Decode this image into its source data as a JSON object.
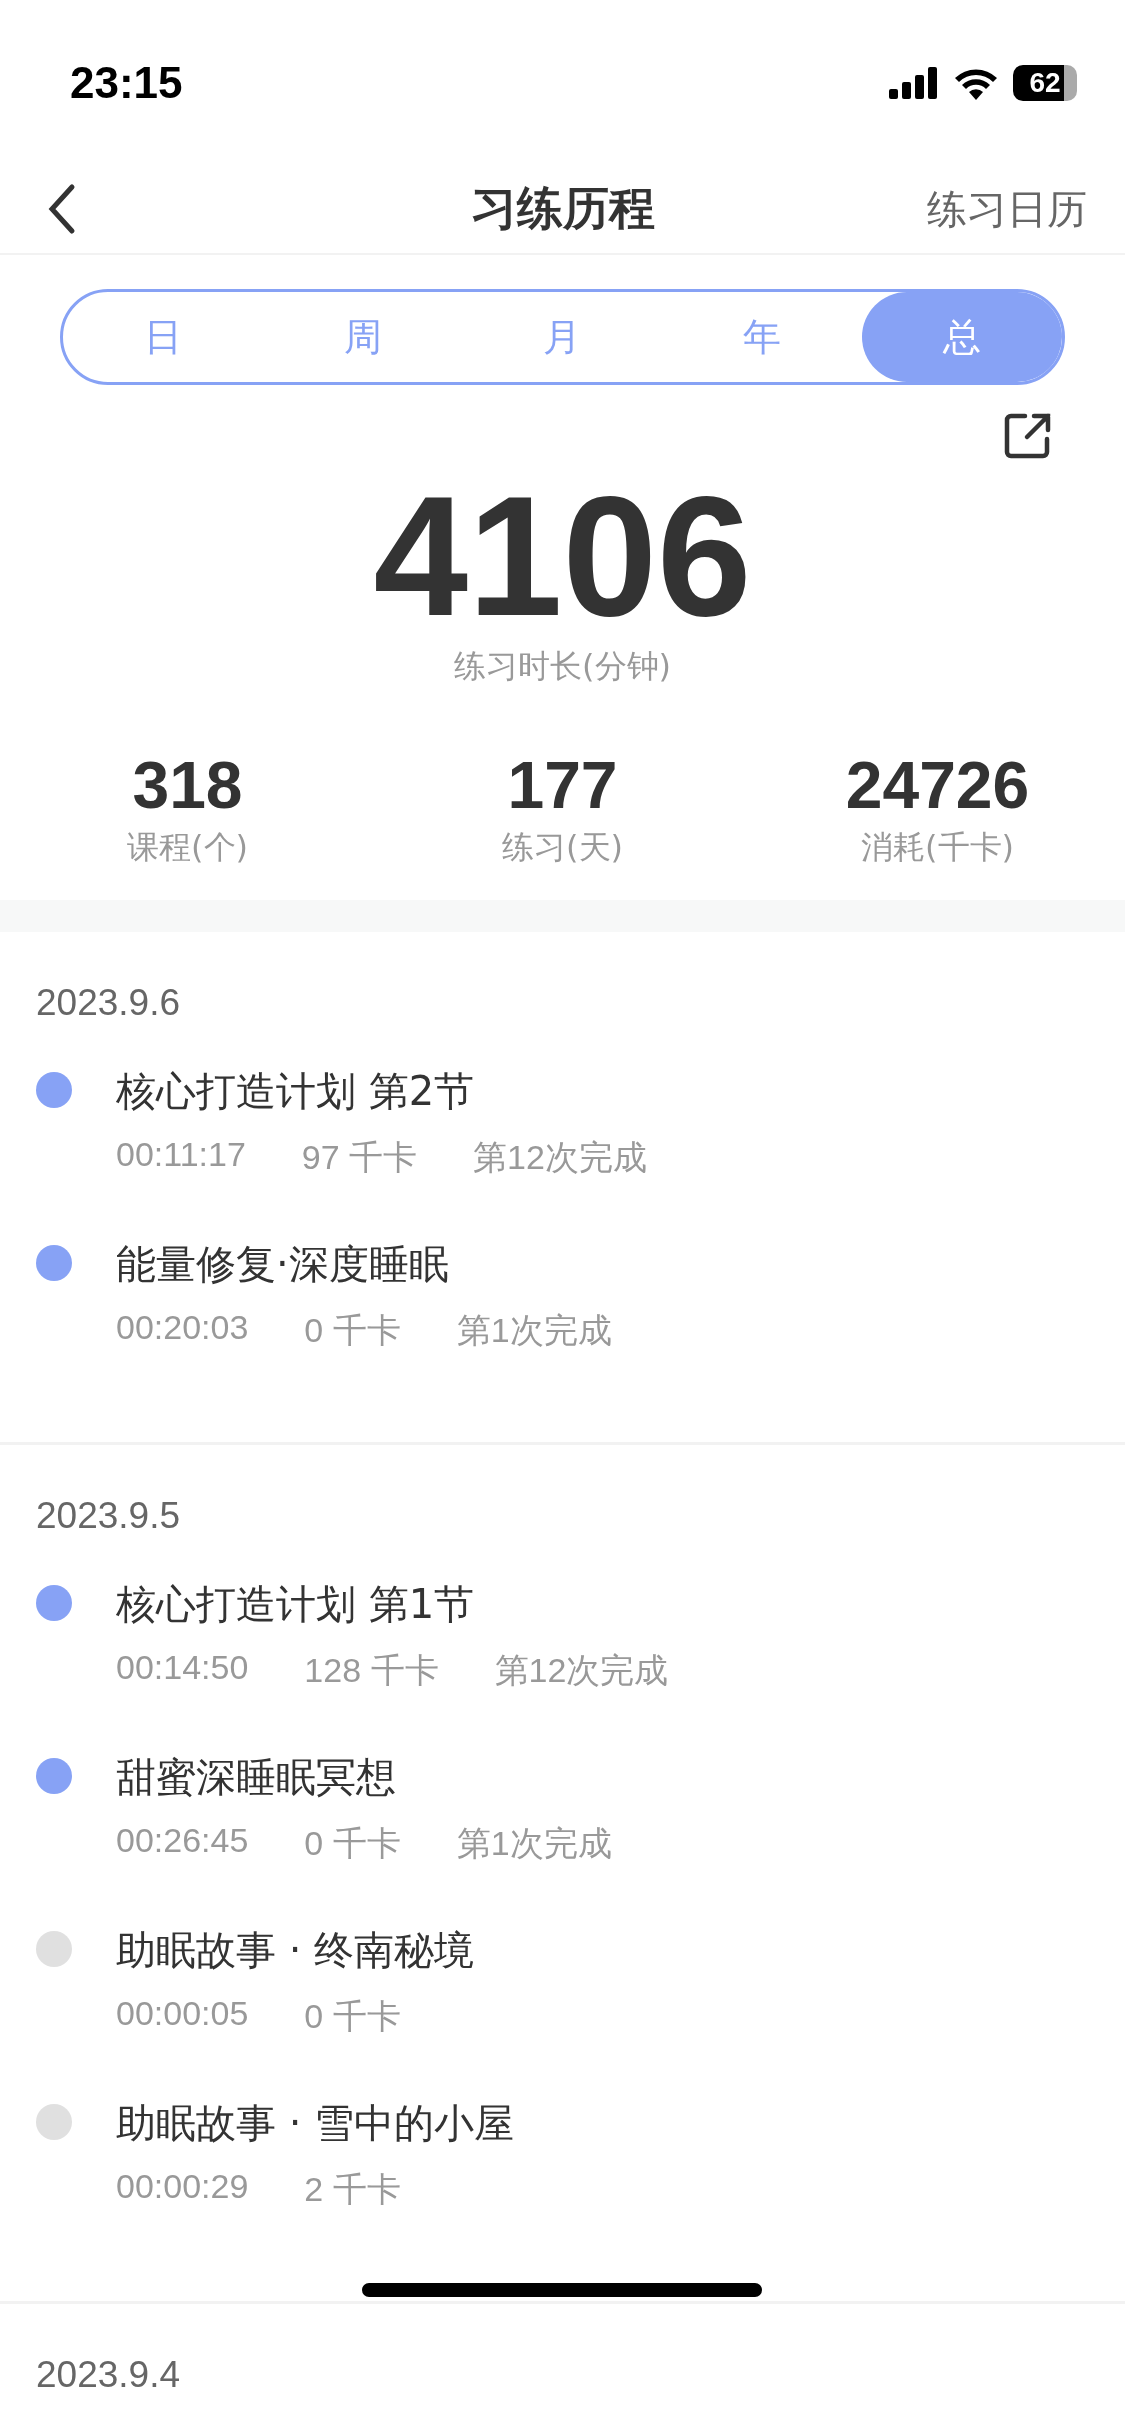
{
  "status_bar": {
    "time": "23:15",
    "battery": "62"
  },
  "header": {
    "title": "习练历程",
    "action": "练习日历"
  },
  "tabs": [
    {
      "label": "日",
      "selected": false
    },
    {
      "label": "周",
      "selected": false
    },
    {
      "label": "月",
      "selected": false
    },
    {
      "label": "年",
      "selected": false
    },
    {
      "label": "总",
      "selected": true
    }
  ],
  "summary": {
    "value": "4106",
    "label": "练习时长(分钟)"
  },
  "stats": [
    {
      "value": "318",
      "label": "课程(个)"
    },
    {
      "value": "177",
      "label": "练习(天)"
    },
    {
      "value": "24726",
      "label": "消耗(千卡)"
    }
  ],
  "days": [
    {
      "date": "2023.9.6",
      "sessions": [
        {
          "title": "核心打造计划 第2节",
          "color": "#87a2f5",
          "duration": "00:11:17",
          "calories": "97 千卡",
          "completion": "第12次完成"
        },
        {
          "title": "能量修复·深度睡眠",
          "color": "#87a2f5",
          "duration": "00:20:03",
          "calories": "0 千卡",
          "completion": "第1次完成"
        }
      ]
    },
    {
      "date": "2023.9.5",
      "sessions": [
        {
          "title": "核心打造计划 第1节",
          "color": "#87a2f5",
          "duration": "00:14:50",
          "calories": "128 千卡",
          "completion": "第12次完成"
        },
        {
          "title": "甜蜜深睡眠冥想",
          "color": "#87a2f5",
          "duration": "00:26:45",
          "calories": "0 千卡",
          "completion": "第1次完成"
        },
        {
          "title": "助眠故事 · 终南秘境",
          "color": "#e0e0e0",
          "duration": "00:00:05",
          "calories": "0 千卡"
        },
        {
          "title": "助眠故事 · 雪中的小屋",
          "color": "#e0e0e0",
          "duration": "00:00:29",
          "calories": "2 千卡"
        }
      ]
    },
    {
      "date": "2023.9.4"
    }
  ]
}
